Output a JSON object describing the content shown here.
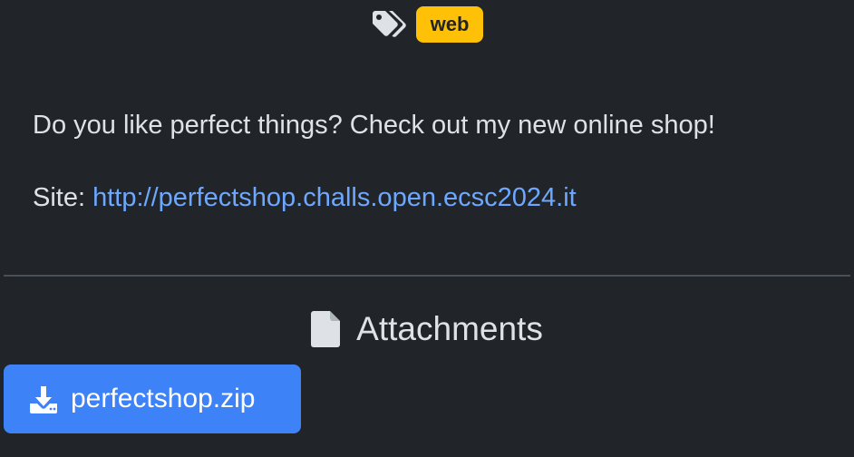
{
  "tags": {
    "icon": "tags-icon",
    "items": [
      "web"
    ]
  },
  "description": {
    "intro": "Do you like perfect things? Check out my new online shop!",
    "site_label": "Site: ",
    "site_url": "http://perfectshop.challs.open.ecsc2024.it"
  },
  "attachments": {
    "heading_icon": "file-icon",
    "heading": "Attachments",
    "files": [
      {
        "icon": "download-icon",
        "label": "perfectshop.zip"
      }
    ]
  },
  "colors": {
    "background": "#212529",
    "tag_badge": "#ffc107",
    "link": "#6ea8fe",
    "button": "#3d82f6"
  }
}
